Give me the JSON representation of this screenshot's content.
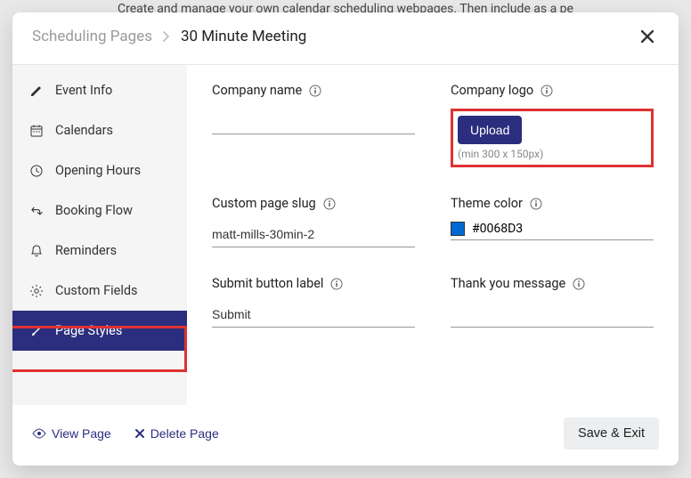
{
  "background_text": "Create and manage your own calendar scheduling webpages. Then include as a pe",
  "breadcrumb": {
    "root": "Scheduling Pages",
    "current": "30 Minute Meeting"
  },
  "sidebar": {
    "items": [
      {
        "label": "Event Info"
      },
      {
        "label": "Calendars"
      },
      {
        "label": "Opening Hours"
      },
      {
        "label": "Booking Flow"
      },
      {
        "label": "Reminders"
      },
      {
        "label": "Custom Fields"
      },
      {
        "label": "Page Styles"
      }
    ]
  },
  "form": {
    "company_name": {
      "label": "Company name",
      "value": ""
    },
    "company_logo": {
      "label": "Company logo",
      "button": "Upload",
      "hint": "(min 300 x 150px)"
    },
    "slug": {
      "label": "Custom page slug",
      "value": "matt-mills-30min-2"
    },
    "theme_color": {
      "label": "Theme color",
      "value": "#0068D3",
      "swatch": "#0068D3"
    },
    "submit_label": {
      "label": "Submit button label",
      "value": "Submit"
    },
    "thank_you": {
      "label": "Thank you message",
      "value": ""
    }
  },
  "footer": {
    "view": "View Page",
    "delete": "Delete Page",
    "save": "Save & Exit"
  }
}
